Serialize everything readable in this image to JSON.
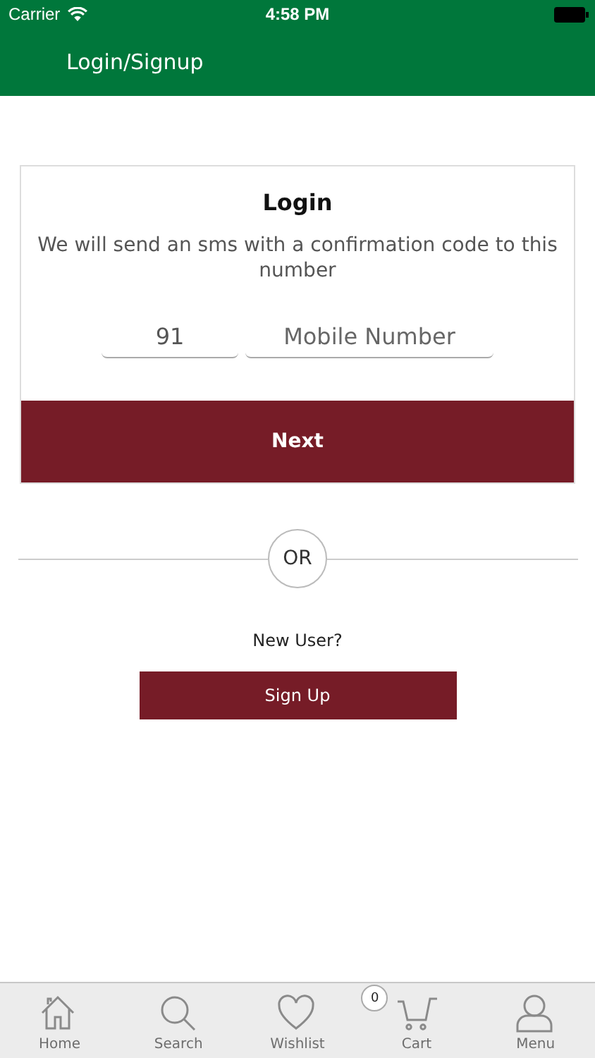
{
  "status_bar": {
    "carrier": "Carrier",
    "time": "4:58 PM"
  },
  "nav_bar": {
    "title": "Login/Signup"
  },
  "login_card": {
    "title": "Login",
    "message": "We will send an sms with a confirmation code to this number",
    "country_code": {
      "value": "91"
    },
    "mobile": {
      "placeholder": "Mobile Number"
    },
    "button": "Next"
  },
  "divider": {
    "label": "OR"
  },
  "signup": {
    "prompt": "New User?",
    "button": "Sign Up"
  },
  "tab_bar": [
    {
      "kind": "home",
      "label": "Home",
      "selected": false
    },
    {
      "kind": "search",
      "label": "Search",
      "selected": false
    },
    {
      "kind": "wishlist",
      "label": "Wishlist",
      "selected": false
    },
    {
      "kind": "cart",
      "label": "Cart",
      "selected": false,
      "badge": "0"
    },
    {
      "kind": "menu",
      "label": "Menu",
      "selected": false
    }
  ]
}
